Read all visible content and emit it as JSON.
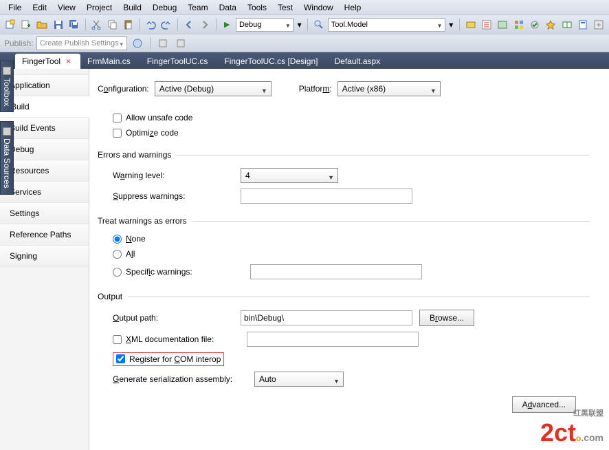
{
  "menu": {
    "items": [
      "File",
      "Edit",
      "View",
      "Project",
      "Build",
      "Debug",
      "Team",
      "Data",
      "Tools",
      "Test",
      "Window",
      "Help"
    ]
  },
  "toolbar": {
    "config_combo": "Debug",
    "platform_combo": "Tool.Model",
    "publish_label": "Publish:",
    "publish_combo": "Create Publish Settings"
  },
  "side": {
    "toolbox": "Toolbox",
    "datasources": "Data Sources"
  },
  "tabs": [
    {
      "label": "FingerTool",
      "active": true,
      "closable": true
    },
    {
      "label": "FrmMain.cs",
      "active": false
    },
    {
      "label": "FingerToolUC.cs",
      "active": false
    },
    {
      "label": "FingerToolUC.cs [Design]",
      "active": false
    },
    {
      "label": "Default.aspx",
      "active": false
    }
  ],
  "nav": {
    "items": [
      "Application",
      "Build",
      "Build Events",
      "Debug",
      "Resources",
      "Services",
      "Settings",
      "Reference Paths",
      "Signing"
    ],
    "active": "Build"
  },
  "cfg": {
    "configuration_label": "Configuration:",
    "configuration_value": "Active (Debug)",
    "platform_label": "Platform:",
    "platform_value": "Active (x86)"
  },
  "build": {
    "allow_unsafe": "Allow unsafe code",
    "optimize": "Optimize code",
    "errors_hdr": "Errors and warnings",
    "warning_level_label": "Warning level:",
    "warning_level_value": "4",
    "suppress_label": "Suppress warnings:",
    "suppress_value": "",
    "treat_hdr": "Treat warnings as errors",
    "none": "None",
    "all": "All",
    "specific": "Specific warnings:",
    "specific_value": "",
    "output_hdr": "Output",
    "output_path_label": "Output path:",
    "output_path_value": "bin\\Debug\\",
    "browse": "Browse...",
    "xml_doc": "XML documentation file:",
    "register_com": "Register for COM interop",
    "gen_serial_label": "Generate serialization assembly:",
    "gen_serial_value": "Auto",
    "advanced": "Advanced..."
  },
  "watermark": {
    "brand": "2cto",
    "suffix": ".com",
    "cn": "红黑联盟"
  }
}
